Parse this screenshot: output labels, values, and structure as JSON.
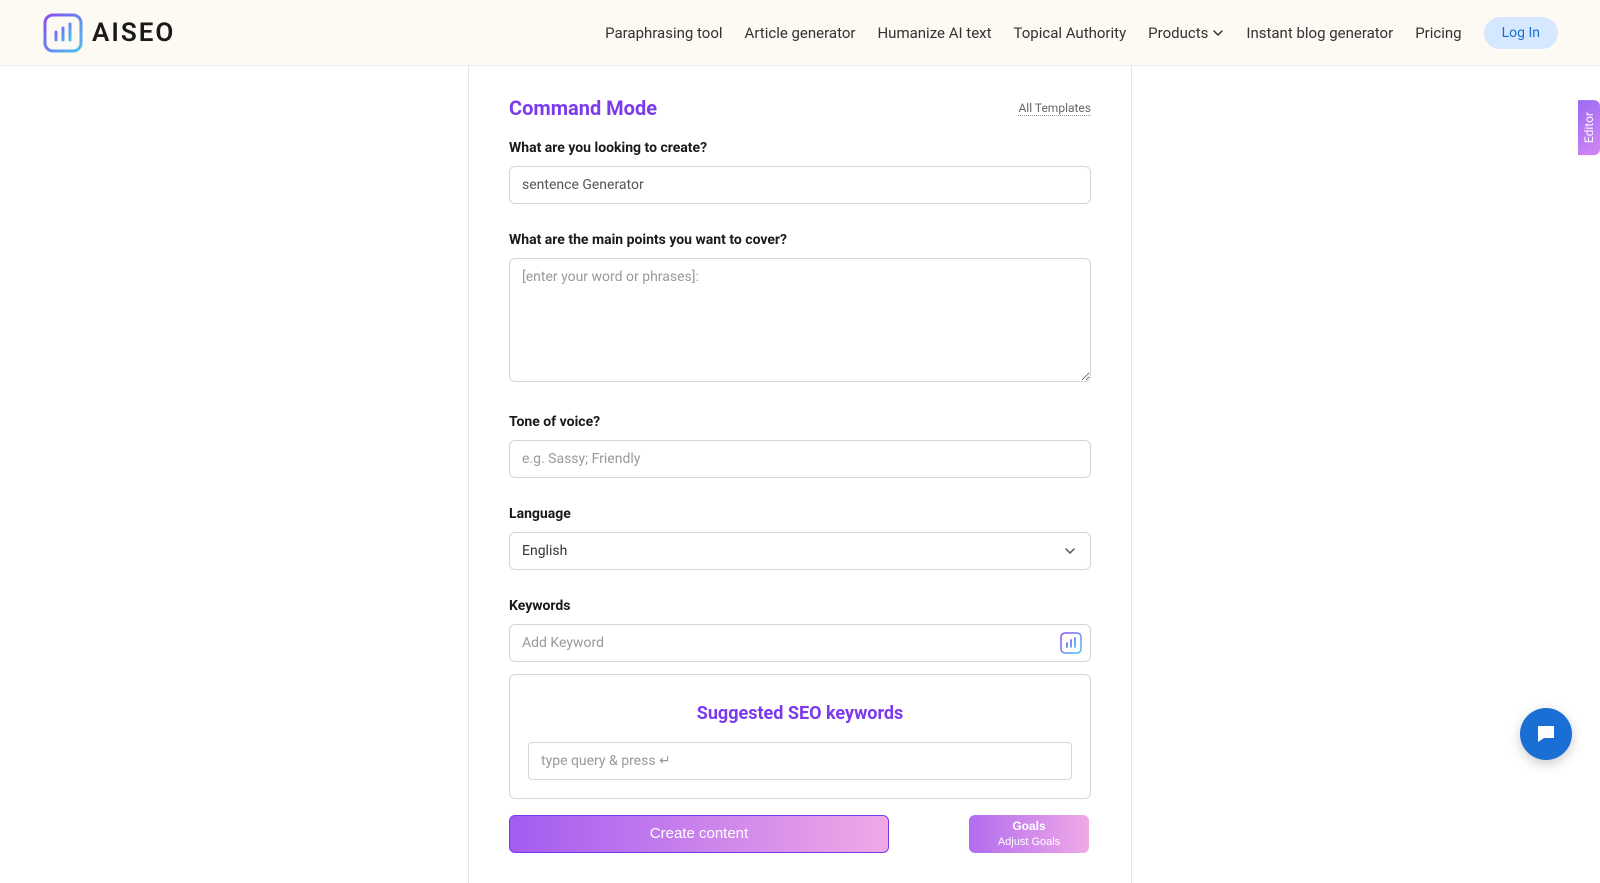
{
  "header": {
    "brand_text": "AISEO",
    "nav": [
      "Paraphrasing tool",
      "Article generator",
      "Humanize AI text",
      "Topical Authority",
      "Products",
      "Instant blog generator",
      "Pricing"
    ],
    "login_label": "Log In"
  },
  "panel": {
    "title": "Command Mode",
    "all_templates": "All Templates",
    "q1_label": "What are you looking to create?",
    "q1_value": "sentence Generator",
    "q2_label": "What are the main points you want to cover?",
    "q2_placeholder": "[enter your word or phrases]:",
    "tone_label": "Tone of voice?",
    "tone_placeholder": "e.g. Sassy; Friendly",
    "language_label": "Language",
    "language_value": "English",
    "keywords_label": "Keywords",
    "keywords_placeholder": "Add Keyword",
    "seo_title": "Suggested SEO keywords",
    "seo_placeholder": "type query & press ↵",
    "create_button": "Create content",
    "goals_line1": "Goals",
    "goals_line2": "Adjust Goals"
  },
  "side_tab": "Editor"
}
